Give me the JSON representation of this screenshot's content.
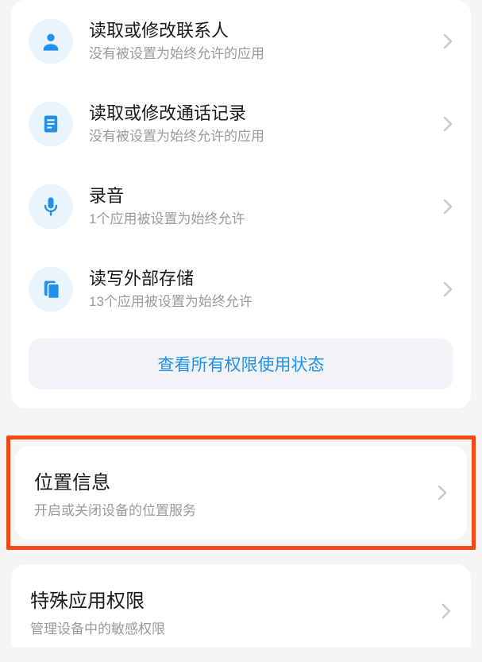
{
  "permissions": [
    {
      "icon": "contacts-icon",
      "title": "读取或修改联系人",
      "sub": "没有被设置为始终允许的应用"
    },
    {
      "icon": "call-log-icon",
      "title": "读取或修改通话记录",
      "sub": "没有被设置为始终允许的应用"
    },
    {
      "icon": "microphone-icon",
      "title": "录音",
      "sub": "1个应用被设置为始终允许"
    },
    {
      "icon": "storage-icon",
      "title": "读写外部存储",
      "sub": "13个应用被设置为始终允许"
    }
  ],
  "view_all_label": "查看所有权限使用状态",
  "location": {
    "title": "位置信息",
    "sub": "开启或关闭设备的位置服务"
  },
  "special": {
    "title": "特殊应用权限",
    "sub": "管理设备中的敏感权限"
  },
  "colors": {
    "accent": "#1f91ec",
    "highlight": "#f24a16"
  }
}
